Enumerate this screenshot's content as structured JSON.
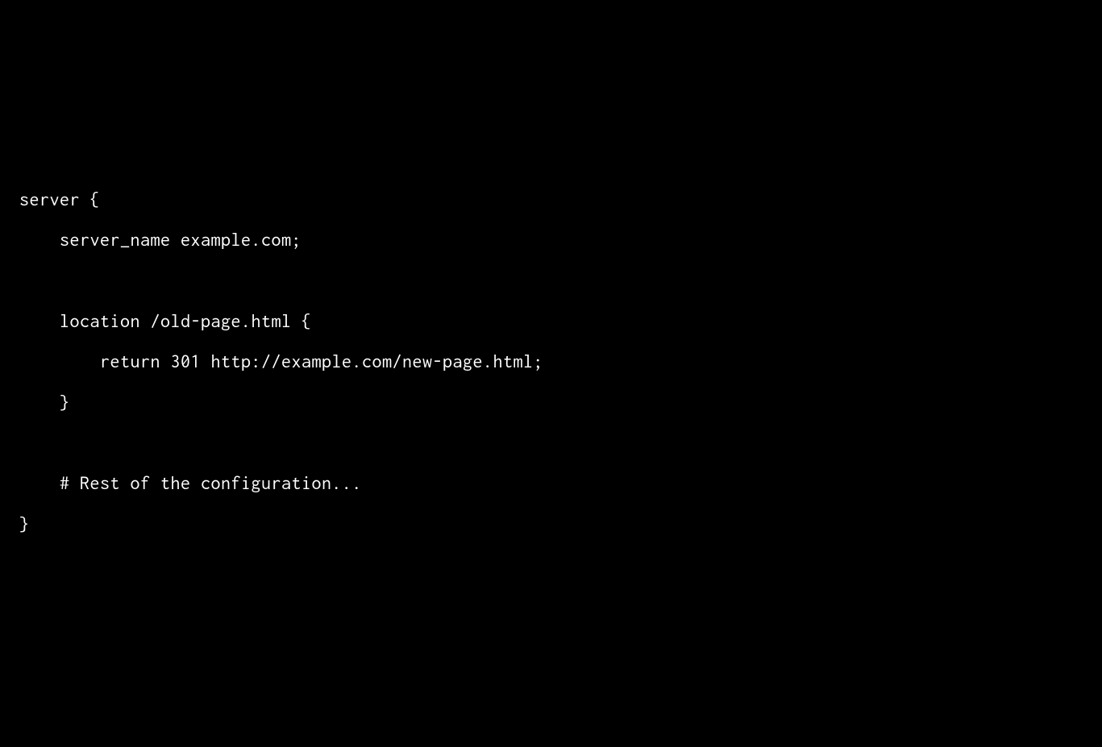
{
  "code": {
    "line1": "server {",
    "line2": "    server_name example.com;",
    "line3": "",
    "line4": "    location /old-page.html {",
    "line5": "        return 301 http://example.com/new-page.html;",
    "line6": "    }",
    "line7": "",
    "line8": "    # Rest of the configuration...",
    "line9": "}"
  }
}
